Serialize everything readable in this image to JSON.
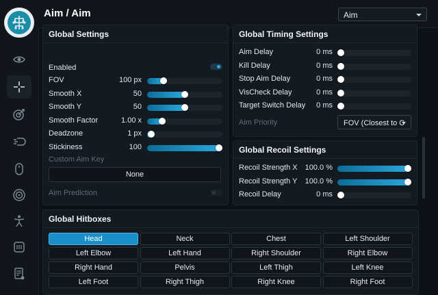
{
  "header": {
    "title": "Aim / Aim",
    "preset": "Aim"
  },
  "global_settings": {
    "title": "Global Settings",
    "enabled_label": "Enabled",
    "enabled_on": true,
    "sliders": [
      {
        "label": "FOV",
        "value": "100 px",
        "fraction": 0.22
      },
      {
        "label": "Smooth X",
        "value": "50",
        "fraction": 0.5
      },
      {
        "label": "Smooth Y",
        "value": "50",
        "fraction": 0.5
      },
      {
        "label": "Smooth Factor",
        "value": "1.00 x",
        "fraction": 0.2
      },
      {
        "label": "Deadzone",
        "value": "1 px",
        "fraction": 0.05
      },
      {
        "label": "Stickiness",
        "value": "100",
        "fraction": 1.0
      }
    ],
    "custom_aim_key_label": "Custom Aim Key",
    "custom_aim_key_value": "None",
    "aim_prediction_label": "Aim Prediction",
    "aim_prediction_on": false
  },
  "timing": {
    "title": "Global Timing Settings",
    "rows": [
      {
        "label": "Aim Delay",
        "value": "0 ms",
        "fraction": 0
      },
      {
        "label": "Kill Delay",
        "value": "0 ms",
        "fraction": 0
      },
      {
        "label": "Stop Aim Delay",
        "value": "0 ms",
        "fraction": 0
      },
      {
        "label": "VisCheck Delay",
        "value": "0 ms",
        "fraction": 0
      },
      {
        "label": "Target Switch Delay",
        "value": "0 ms",
        "fraction": 0
      }
    ],
    "aim_priority_label": "Aim Priority",
    "aim_priority_value": "FOV (Closest to C"
  },
  "recoil": {
    "title": "Global Recoil Settings",
    "rows": [
      {
        "label": "Recoil Strength X",
        "value": "100.0 %",
        "fraction": 1.0
      },
      {
        "label": "Recoil Strength Y",
        "value": "100.0 %",
        "fraction": 1.0
      },
      {
        "label": "Recoil Delay",
        "value": "0 ms",
        "fraction": 0
      }
    ]
  },
  "hitboxes": {
    "title": "Global Hitboxes",
    "items": [
      {
        "label": "Head",
        "selected": true
      },
      {
        "label": "Neck",
        "selected": false
      },
      {
        "label": "Chest",
        "selected": false
      },
      {
        "label": "Left Shoulder",
        "selected": false
      },
      {
        "label": "Left Elbow",
        "selected": false
      },
      {
        "label": "Left Hand",
        "selected": false
      },
      {
        "label": "Right Shoulder",
        "selected": false
      },
      {
        "label": "Right Elbow",
        "selected": false
      },
      {
        "label": "Right Hand",
        "selected": false
      },
      {
        "label": "Pelvis",
        "selected": false
      },
      {
        "label": "Left Thigh",
        "selected": false
      },
      {
        "label": "Left Knee",
        "selected": false
      },
      {
        "label": "Left Foot",
        "selected": false
      },
      {
        "label": "Right Thigh",
        "selected": false
      },
      {
        "label": "Right Knee",
        "selected": false
      },
      {
        "label": "Right Foot",
        "selected": false
      }
    ]
  },
  "sidebar": {
    "icons": [
      "eye-icon",
      "crosshair-icon",
      "target-arrow-icon",
      "speed-bullet-icon",
      "mouse-icon",
      "radar-icon",
      "person-icon",
      "hud-icon",
      "config-list-icon"
    ],
    "active_index": 1
  },
  "colors": {
    "accent": "#1a8ec7",
    "background": "#0d1218",
    "panel": "#131a21"
  }
}
